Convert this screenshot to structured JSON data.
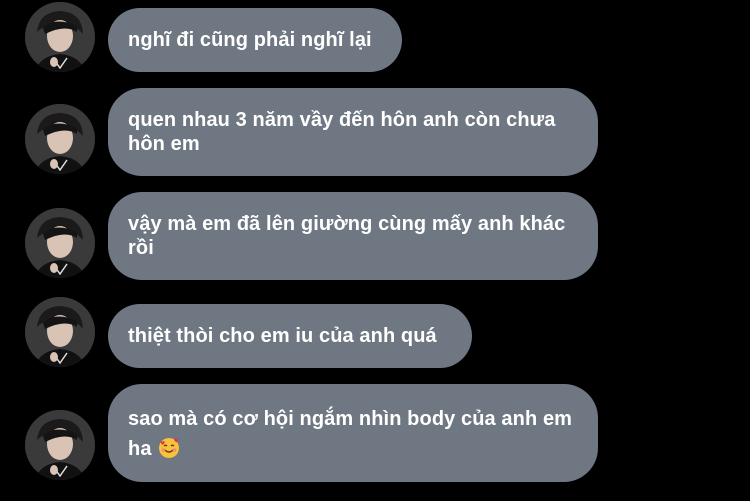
{
  "theme": {
    "background": "#000000",
    "bubble_color": "#6e7782",
    "text_color": "#ffffff"
  },
  "messages": [
    {
      "text": "nghĩ đi cũng phải nghĩ lại",
      "avatar_icon": "profile-photo"
    },
    {
      "text": "quen nhau 3 năm vầy đến hôn anh còn chưa hôn em",
      "avatar_icon": "profile-photo"
    },
    {
      "text": "vậy mà em đã lên giường cùng mấy anh khác rồi",
      "avatar_icon": "profile-photo"
    },
    {
      "text": "thiệt thòi cho em iu của anh quá",
      "avatar_icon": "profile-photo"
    },
    {
      "text": "sao mà có cơ hội ngắm nhìn body của anh em ha",
      "avatar_icon": "profile-photo",
      "emoji": "smiling-face-with-hearts"
    }
  ]
}
